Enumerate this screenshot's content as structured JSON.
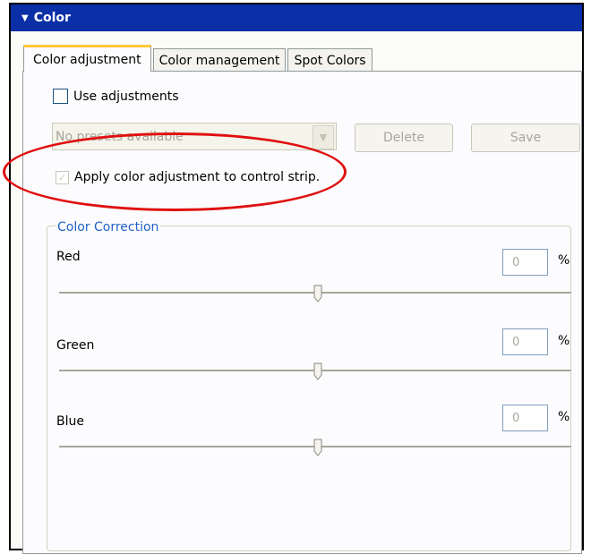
{
  "window": {
    "title": "Color"
  },
  "tabs": [
    {
      "label": "Color adjustment",
      "active": true
    },
    {
      "label": "Color management",
      "active": false
    },
    {
      "label": "Spot Colors",
      "active": false
    }
  ],
  "use_adjustments": {
    "label": "Use adjustments",
    "checked": false
  },
  "preset_combo": {
    "value": "No presets available",
    "enabled": false
  },
  "buttons": {
    "delete": "Delete",
    "save": "Save"
  },
  "apply_control_strip": {
    "label": "Apply color adjustment to control strip.",
    "checked": true,
    "enabled": false
  },
  "color_correction": {
    "title": "Color Correction",
    "channels": [
      {
        "label": "Red",
        "value": "0",
        "unit": "%"
      },
      {
        "label": "Green",
        "value": "0",
        "unit": "%"
      },
      {
        "label": "Blue",
        "value": "0",
        "unit": "%"
      }
    ]
  },
  "colors": {
    "titlebar": "#0a2fa6",
    "highlight_oval": "#e01010",
    "group_title": "#2161c9",
    "active_tab_accent": "#ffc83c"
  }
}
